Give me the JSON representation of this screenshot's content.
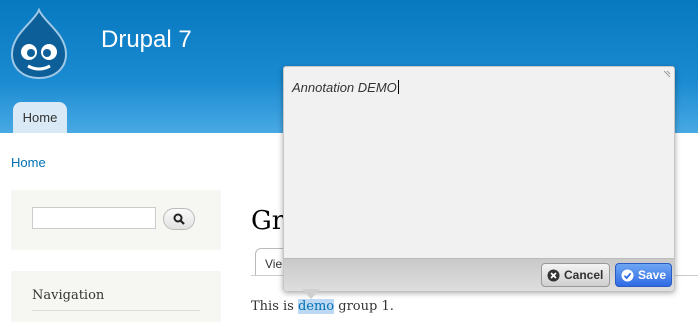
{
  "header": {
    "site_name": "Drupal 7",
    "logo_icon": "drupal-drop-logo",
    "tabs": [
      {
        "label": "Home"
      }
    ]
  },
  "breadcrumb": {
    "items": [
      {
        "label": "Home"
      }
    ]
  },
  "sidebar": {
    "search": {
      "placeholder": "",
      "button_icon": "search-icon"
    },
    "navigation": {
      "title": "Navigation"
    }
  },
  "main": {
    "title": "Gr",
    "tabs": [
      {
        "label": "Vie"
      }
    ],
    "body": {
      "before": "This is ",
      "highlight": "demo",
      "after": " group 1."
    }
  },
  "annotation_popup": {
    "text": "Annotation DEMO",
    "cancel_label": "Cancel",
    "save_label": "Save",
    "cancel_icon": "close-circle-icon",
    "save_icon": "check-circle-icon"
  },
  "colors": {
    "header_blue": "#0779bf",
    "link_blue": "#0071b3",
    "save_blue": "#2f6be4",
    "highlight": "#bdd8f3"
  }
}
